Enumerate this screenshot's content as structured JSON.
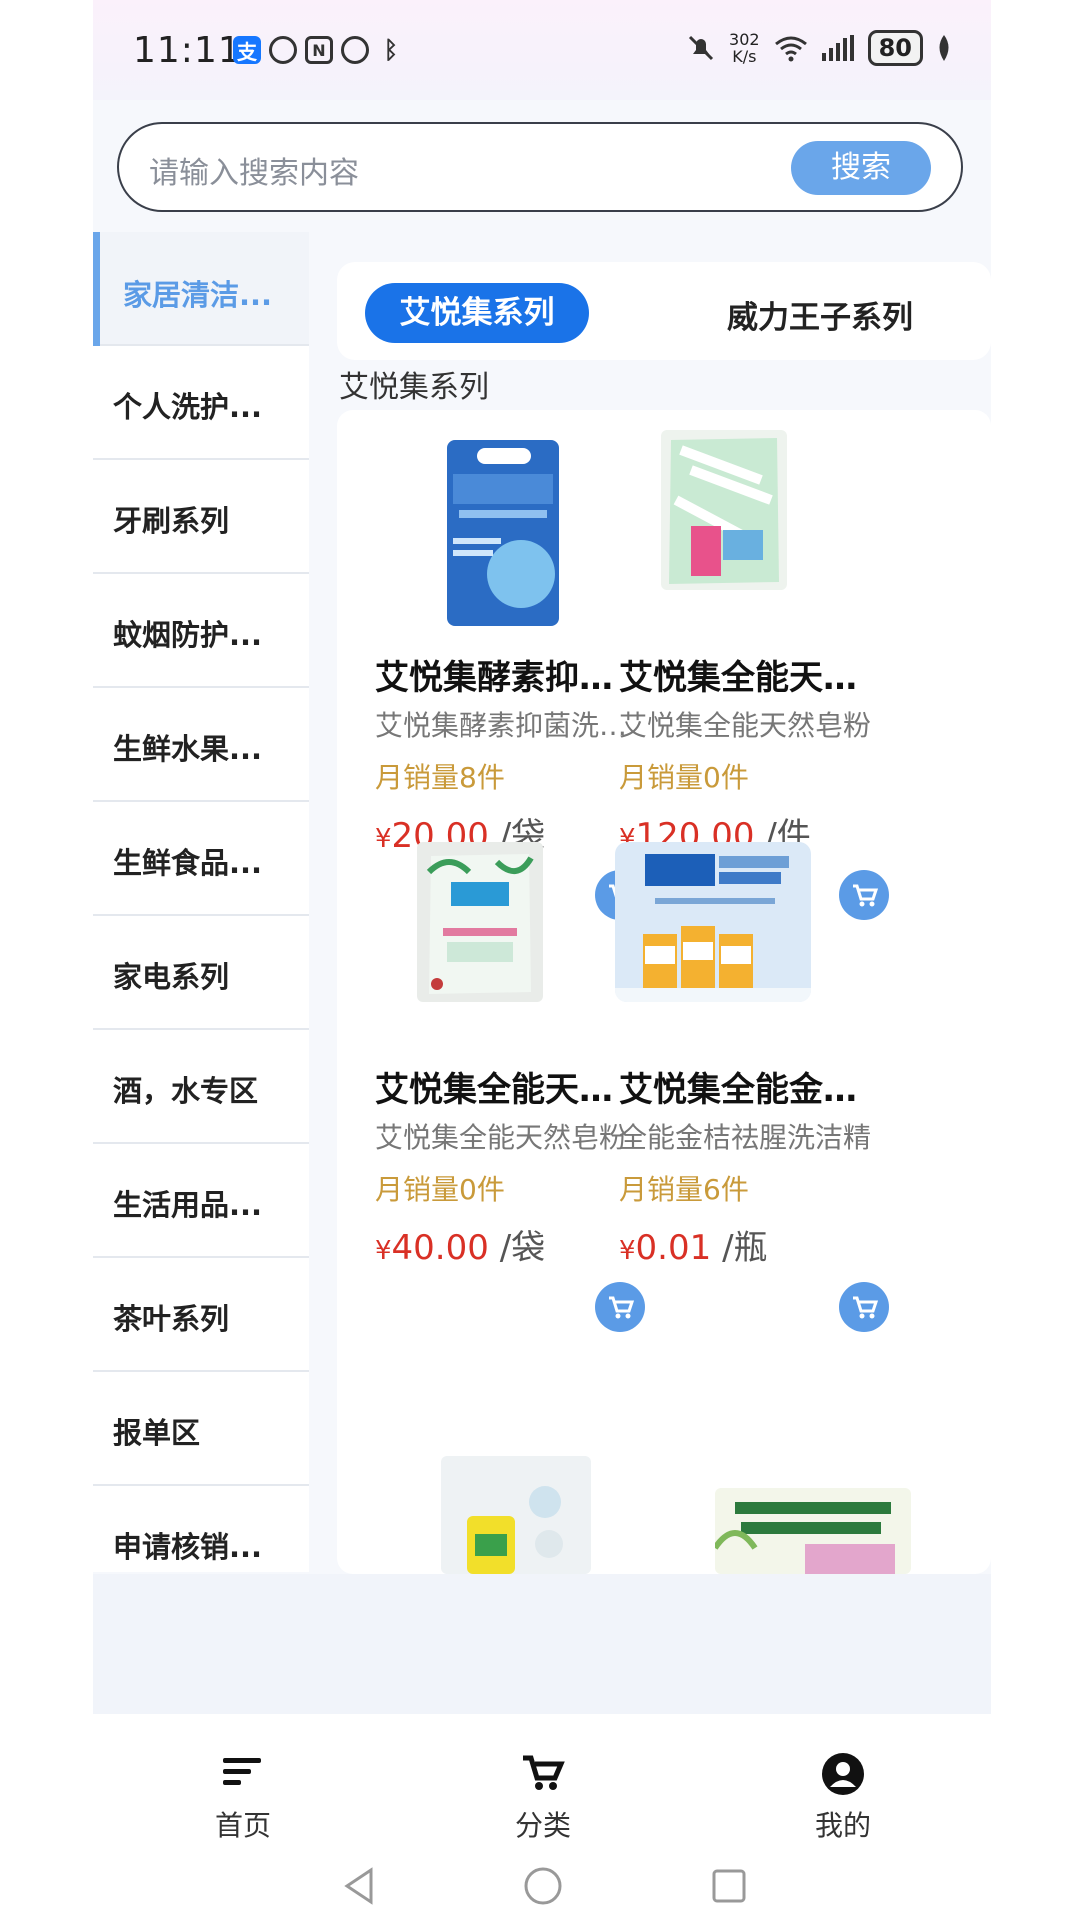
{
  "status_bar": {
    "time": "11:11",
    "speed_top": "302",
    "speed_bottom": "K/s",
    "battery": "80"
  },
  "search": {
    "placeholder": "请输入搜索内容",
    "button": "搜索"
  },
  "sidebar": {
    "items": [
      {
        "label": "家居清洁..."
      },
      {
        "label": "个人洗护..."
      },
      {
        "label": "牙刷系列"
      },
      {
        "label": "蚊烟防护..."
      },
      {
        "label": "生鲜水果..."
      },
      {
        "label": "生鲜食品..."
      },
      {
        "label": "家电系列"
      },
      {
        "label": "酒，水专区"
      },
      {
        "label": "生活用品..."
      },
      {
        "label": "茶叶系列"
      },
      {
        "label": "报单区"
      },
      {
        "label": "申请核销..."
      }
    ]
  },
  "tabs": [
    {
      "label": "艾悦集系列"
    },
    {
      "label": "威力王子系列"
    }
  ],
  "section_title": "艾悦集系列",
  "products": [
    {
      "name": "艾悦集酵素抑菌洗衣粉",
      "desc": "艾悦集酵素抑菌洗衣粉",
      "sales": "月销量8件",
      "currency": "¥",
      "price": "20.00",
      "unit": "/袋"
    },
    {
      "name": "艾悦集全能天然皂粉",
      "desc": "艾悦集全能天然皂粉",
      "sales": "月销量0件",
      "currency": "¥",
      "price": "120.00",
      "unit": "/件"
    },
    {
      "name": "艾悦集全能天然皂粉",
      "desc": "艾悦集全能天然皂粉",
      "sales": "月销量0件",
      "currency": "¥",
      "price": "40.00",
      "unit": "/袋"
    },
    {
      "name": "艾悦集全能金桔洗洁精",
      "desc": "全能金桔祛腥洗洁精",
      "sales": "月销量6件",
      "currency": "¥",
      "price": "0.01",
      "unit": "/瓶"
    }
  ],
  "bottom_nav": [
    {
      "label": "首页"
    },
    {
      "label": "分类"
    },
    {
      "label": "我的"
    }
  ],
  "colors": {
    "accent": "#1a73e8",
    "light_accent": "#6aa6ea",
    "price": "#d93025",
    "sales": "#c99a3a"
  }
}
